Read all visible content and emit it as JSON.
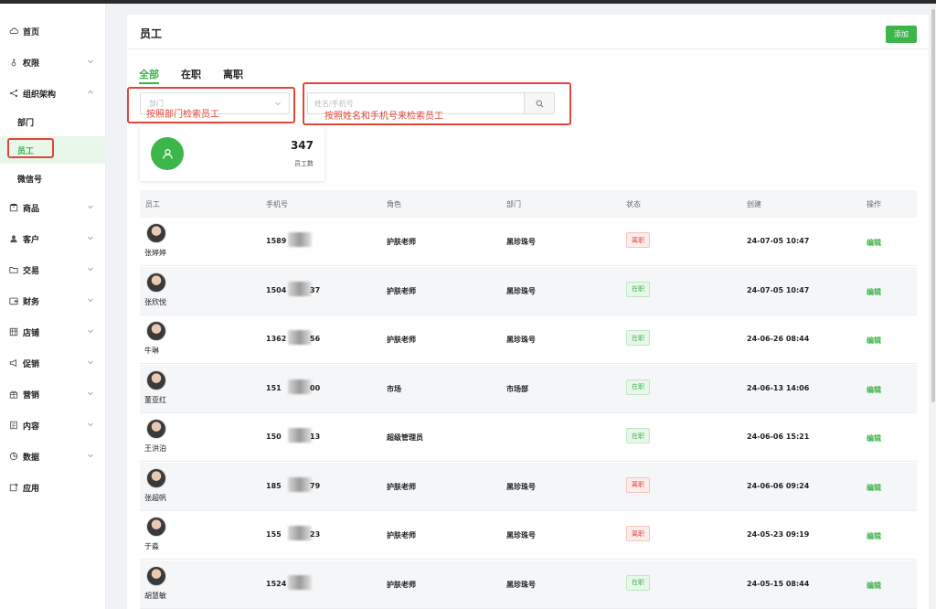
{
  "sidebar": {
    "items": [
      {
        "label": "首页",
        "icon": "cloud-icon",
        "has_chevron": false
      },
      {
        "label": "权限",
        "icon": "key-icon",
        "has_chevron": true
      },
      {
        "label": "组织架构",
        "icon": "share-icon",
        "has_chevron": true,
        "expanded": true
      },
      {
        "label": "商品",
        "icon": "package-icon",
        "has_chevron": true
      },
      {
        "label": "客户",
        "icon": "user-icon",
        "has_chevron": true
      },
      {
        "label": "交易",
        "icon": "folder-icon",
        "has_chevron": true
      },
      {
        "label": "财务",
        "icon": "wallet-icon",
        "has_chevron": true
      },
      {
        "label": "店铺",
        "icon": "store-icon",
        "has_chevron": true
      },
      {
        "label": "促销",
        "icon": "megaphone-icon",
        "has_chevron": true
      },
      {
        "label": "营销",
        "icon": "gift-icon",
        "has_chevron": true
      },
      {
        "label": "内容",
        "icon": "document-icon",
        "has_chevron": true
      },
      {
        "label": "数据",
        "icon": "pie-chart-icon",
        "has_chevron": true
      },
      {
        "label": "应用",
        "icon": "app-icon",
        "has_chevron": false
      }
    ],
    "sub_items": [
      {
        "label": "部门"
      },
      {
        "label": "员工",
        "active": true
      },
      {
        "label": "微信号"
      }
    ]
  },
  "header": {
    "title": "员工",
    "add_label": "添加"
  },
  "tabs": [
    {
      "label": "全部",
      "active": true
    },
    {
      "label": "在职"
    },
    {
      "label": "离职"
    }
  ],
  "filters": {
    "dept_placeholder": "部门",
    "search_placeholder": "姓名/手机号"
  },
  "annotations": {
    "dept_note": "按照部门检索员工",
    "search_note": "按照姓名和手机号来检索员工",
    "color": "#e0463a"
  },
  "stat": {
    "value": "347",
    "label": "员工数"
  },
  "table": {
    "columns": [
      "员工",
      "手机号",
      "角色",
      "部门",
      "状态",
      "创建",
      "操作"
    ],
    "rows": [
      {
        "name": "张婷婷",
        "phone_start": "1589",
        "phone_end": "",
        "role": "护肤老师",
        "dept": "黑珍珠号",
        "status": "离职",
        "created": "24-07-05 10:47",
        "action": "编辑"
      },
      {
        "name": "张欣悦",
        "phone_start": "1504",
        "phone_end": "37",
        "role": "护肤老师",
        "dept": "黑珍珠号",
        "status": "在职",
        "created": "24-07-05 10:47",
        "action": "编辑"
      },
      {
        "name": "牛琳",
        "phone_start": "1362",
        "phone_end": "56",
        "role": "护肤老师",
        "dept": "黑珍珠号",
        "status": "在职",
        "created": "24-06-26 08:44",
        "action": "编辑"
      },
      {
        "name": "董亚红",
        "phone_start": "151",
        "phone_end": "00",
        "role": "市场",
        "dept": "市场部",
        "status": "在职",
        "created": "24-06-13 14:06",
        "action": "编辑"
      },
      {
        "name": "王洪泊",
        "phone_start": "150",
        "phone_end": "13",
        "role": "超级管理员",
        "dept": "",
        "status": "在职",
        "created": "24-06-06 15:21",
        "action": "编辑"
      },
      {
        "name": "张超帆",
        "phone_start": "185",
        "phone_end": "79",
        "role": "护肤老师",
        "dept": "黑珍珠号",
        "status": "离职",
        "created": "24-06-06 09:24",
        "action": "编辑"
      },
      {
        "name": "于淼",
        "phone_start": "155",
        "phone_end": "23",
        "role": "护肤老师",
        "dept": "黑珍珠号",
        "status": "离职",
        "created": "24-05-23 09:19",
        "action": "编辑"
      },
      {
        "name": "胡慧敏",
        "phone_start": "1524",
        "phone_end": "",
        "role": "护肤老师",
        "dept": "黑珍珠号",
        "status": "在职",
        "created": "24-05-15 08:44",
        "action": "编辑"
      }
    ]
  },
  "colors": {
    "accent": "#3cb54a",
    "left_status": "#e0463a"
  }
}
